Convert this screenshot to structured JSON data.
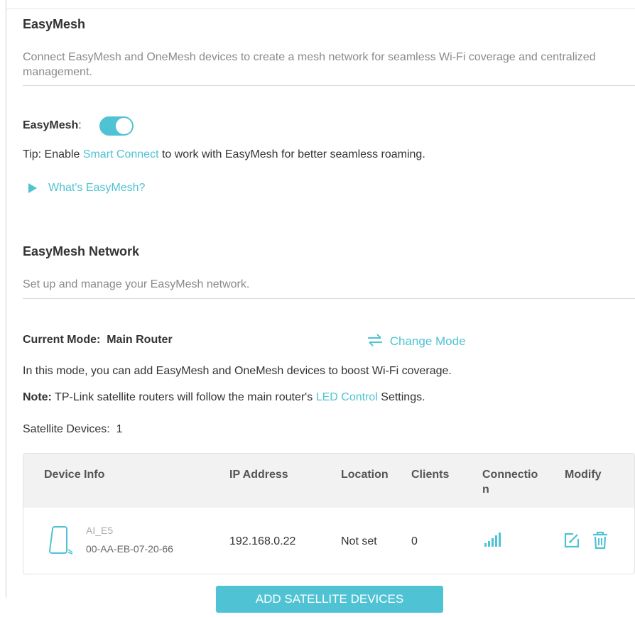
{
  "easymesh": {
    "title": "EasyMesh",
    "description": "Connect EasyMesh and OneMesh devices to create a mesh network for seamless Wi-Fi coverage and centralized management.",
    "toggle_label": "EasyMesh",
    "toggle_colon": ":",
    "toggle_on": true,
    "tip_prefix": "Tip: Enable ",
    "tip_link": "Smart Connect",
    "tip_suffix": " to work with EasyMesh for better seamless roaming.",
    "whats_link": "What's EasyMesh?"
  },
  "network": {
    "title": "EasyMesh Network",
    "description": "Set up and manage your EasyMesh network.",
    "current_mode_label": "Current Mode:",
    "current_mode_value": "Main Router",
    "change_mode": "Change Mode",
    "mode_text": "In this mode, you can add EasyMesh and OneMesh devices to boost Wi-Fi coverage.",
    "note_label": "Note:",
    "note_prefix": " TP-Link satellite routers will follow the main router's ",
    "note_link": "LED Control",
    "note_suffix": " Settings.",
    "satellite_label": "Satellite Devices:",
    "satellite_count": "1"
  },
  "table": {
    "headers": {
      "device": "Device Info",
      "ip": "IP Address",
      "location": "Location",
      "clients": "Clients",
      "connection_line1": "Connectio",
      "connection_line2": "n",
      "modify": "Modify"
    },
    "rows": [
      {
        "name": "AI_E5",
        "mac": "00-AA-EB-07-20-66",
        "ip": "192.168.0.22",
        "location": "Not set",
        "clients": "0",
        "signal_level": 4
      }
    ]
  },
  "add_button": "ADD SATELLITE DEVICES",
  "colors": {
    "accent": "#4fc3d3",
    "text": "#333333",
    "muted": "#8a8a8a"
  }
}
